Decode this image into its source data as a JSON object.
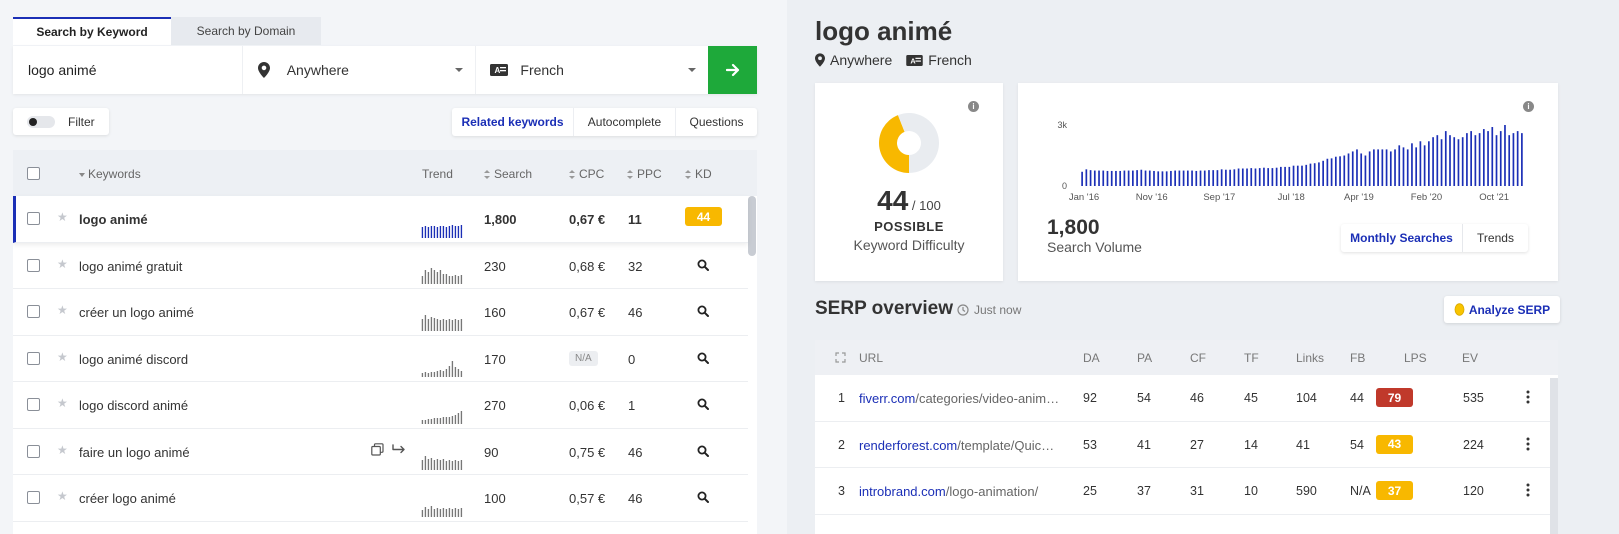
{
  "search": {
    "tabs": [
      "Search by Keyword",
      "Search by Domain"
    ],
    "keyword": "logo animé",
    "location": "Anywhere",
    "language": "French"
  },
  "filter_label": "Filter",
  "kw_tabs": [
    "Related keywords",
    "Autocomplete",
    "Questions"
  ],
  "table": {
    "headers": {
      "keywords": "Keywords",
      "trend": "Trend",
      "search": "Search",
      "cpc": "CPC",
      "ppc": "PPC",
      "kd": "KD"
    },
    "rows": [
      {
        "keyword": "logo animé",
        "search": "1,800",
        "cpc": "0,67 €",
        "ppc": "11",
        "kd": "44",
        "trend": [
          0.55,
          0.6,
          0.55,
          0.6,
          0.6,
          0.55,
          0.6,
          0.6,
          0.55,
          0.6,
          0.65,
          0.6,
          0.6,
          0.65
        ]
      },
      {
        "keyword": "logo animé gratuit",
        "search": "230",
        "cpc": "0,68 €",
        "ppc": "32",
        "kd": "",
        "trend": [
          0.4,
          0.7,
          0.6,
          0.8,
          0.7,
          0.6,
          0.7,
          0.5,
          0.5,
          0.4,
          0.4,
          0.45,
          0.4,
          0.45
        ]
      },
      {
        "keyword": "créer un logo animé",
        "search": "160",
        "cpc": "0,67 €",
        "ppc": "46",
        "kd": "",
        "trend": [
          0.6,
          0.8,
          0.6,
          0.7,
          0.65,
          0.6,
          0.55,
          0.6,
          0.55,
          0.6,
          0.55,
          0.6,
          0.55,
          0.6
        ]
      },
      {
        "keyword": "logo animé discord",
        "search": "170",
        "cpc": "N/A",
        "ppc": "0",
        "kd": "",
        "trend": [
          0.2,
          0.25,
          0.2,
          0.25,
          0.25,
          0.3,
          0.35,
          0.3,
          0.4,
          0.55,
          0.8,
          0.5,
          0.4,
          0.3
        ]
      },
      {
        "keyword": "logo discord animé",
        "search": "270",
        "cpc": "0,06 €",
        "ppc": "1",
        "kd": "",
        "trend": [
          0.2,
          0.2,
          0.25,
          0.25,
          0.3,
          0.3,
          0.3,
          0.35,
          0.35,
          0.35,
          0.4,
          0.45,
          0.55,
          0.65
        ]
      },
      {
        "keyword": "faire un logo animé",
        "search": "90",
        "cpc": "0,75 €",
        "ppc": "46",
        "kd": "",
        "trend": [
          0.5,
          0.7,
          0.55,
          0.6,
          0.5,
          0.55,
          0.5,
          0.55,
          0.45,
          0.5,
          0.45,
          0.5,
          0.45,
          0.5
        ]
      },
      {
        "keyword": "créer logo animé",
        "search": "100",
        "cpc": "0,57 €",
        "ppc": "46",
        "kd": "",
        "trend": [
          0.35,
          0.5,
          0.4,
          0.55,
          0.4,
          0.45,
          0.4,
          0.45,
          0.4,
          0.45,
          0.4,
          0.45,
          0.4,
          0.45
        ]
      }
    ]
  },
  "detail": {
    "title": "logo animé",
    "location": "Anywhere",
    "language": "French",
    "kd": {
      "score": "44",
      "out_of": "/ 100",
      "label": "POSSIBLE",
      "caption": "Keyword Difficulty",
      "value_fraction": 0.44
    },
    "volume": {
      "number": "1,800",
      "caption": "Search Volume",
      "tabs": [
        "Monthly Searches",
        "Trends"
      ]
    }
  },
  "chart_data": {
    "type": "bar",
    "title": "",
    "ylim": [
      0,
      3000
    ],
    "y_ticks": [
      "3k",
      "0"
    ],
    "x_ticks": [
      "Jan '16",
      "Nov '16",
      "Sep '17",
      "Jul '18",
      "Apr '19",
      "Feb '20",
      "Oct '21"
    ],
    "values": [
      700,
      820,
      780,
      760,
      760,
      760,
      740,
      740,
      740,
      740,
      760,
      760,
      760,
      780,
      800,
      760,
      760,
      740,
      720,
      720,
      720,
      740,
      760,
      760,
      760,
      760,
      760,
      740,
      760,
      760,
      780,
      780,
      780,
      820,
      800,
      800,
      820,
      860,
      860,
      860,
      880,
      860,
      880,
      900,
      880,
      880,
      900,
      940,
      940,
      940,
      1000,
      1000,
      1000,
      1040,
      1100,
      1120,
      1160,
      1240,
      1340,
      1360,
      1440,
      1460,
      1500,
      1600,
      1700,
      1800,
      1600,
      1500,
      1700,
      1800,
      1800,
      1800,
      1800,
      1700,
      1800,
      2000,
      1900,
      1800,
      2100,
      1900,
      2200,
      2000,
      2200,
      2400,
      2500,
      2300,
      2700,
      2500,
      2400,
      2300,
      2400,
      2600,
      2700,
      2500,
      2600,
      2800,
      2700,
      2900,
      2500,
      2700,
      3000,
      2500,
      2600,
      2700,
      2600
    ]
  },
  "serp": {
    "title": "SERP overview",
    "time": "Just now",
    "analyze_label": "Analyze SERP",
    "headers": [
      "URL",
      "DA",
      "PA",
      "CF",
      "TF",
      "Links",
      "FB",
      "LPS",
      "EV"
    ],
    "rows": [
      {
        "rank": "1",
        "domain": "fiverr.com",
        "path": "/categories/video-anim…",
        "da": "92",
        "pa": "54",
        "cf": "46",
        "tf": "45",
        "links": "104",
        "fb": "44",
        "lps": "79",
        "lps_color": "#c0392b",
        "ev": "535"
      },
      {
        "rank": "2",
        "domain": "renderforest.com",
        "path": "/template/Quic…",
        "da": "53",
        "pa": "41",
        "cf": "27",
        "tf": "14",
        "links": "41",
        "fb": "54",
        "lps": "43",
        "lps_color": "#f8b800",
        "ev": "224"
      },
      {
        "rank": "3",
        "domain": "introbrand.com",
        "path": "/logo-animation/",
        "da": "25",
        "pa": "37",
        "cf": "31",
        "tf": "10",
        "links": "590",
        "fb": "N/A",
        "lps": "37",
        "lps_color": "#f8b800",
        "ev": "120"
      }
    ]
  },
  "colors": {
    "accent": "#1b2fb6",
    "go_button": "#1ea93a",
    "kd_yellow": "#f8b800"
  }
}
